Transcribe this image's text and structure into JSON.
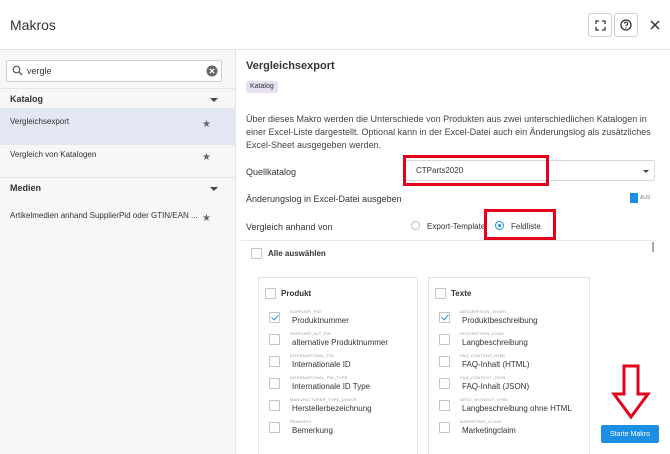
{
  "window": {
    "title": "Makros"
  },
  "toolbar": {
    "fullscreen_icon": "fullscreen-icon",
    "help_icon": "help-icon",
    "close_label": "✕"
  },
  "sidebar": {
    "search": {
      "value": "vergle",
      "placeholder": ""
    },
    "categories": [
      {
        "label": "Katalog",
        "items": [
          {
            "label": "Vergleichsexport",
            "active": true
          },
          {
            "label": "Vergleich von Katalogen",
            "active": false
          }
        ]
      },
      {
        "label": "Medien",
        "items": [
          {
            "label": "Artikelmedien anhand SupplierPid oder GTIN/EAN ...",
            "active": false
          }
        ]
      }
    ]
  },
  "main": {
    "title": "Vergleichsexport",
    "badge": "Katalog",
    "description": "Über dieses Makro werden die Unterschiede von Produkten aus zwei unterschiedlichen Katalogen in einer Excel-Liste dargestellt. Optional kann in der Excel-Datei auch ein Änderungslog als zusätzliches Excel-Sheet ausgegeben werden.",
    "source_label": "Quellkatalog",
    "source_value": "CTParts2020",
    "changelog_label": "Änderungslog in Excel-Datei ausgeben",
    "changelog_toggle": "AUS",
    "compare_label": "Vergleich anhand von",
    "compare_options": [
      {
        "label": "Export-Template",
        "selected": false
      },
      {
        "label": "Feldliste",
        "selected": true
      }
    ],
    "select_all": "Alle auswählen",
    "groups": [
      {
        "title": "Produkt",
        "fields": [
          {
            "key": "SUPPLIER_PID",
            "name": "Produktnummer",
            "checked": true
          },
          {
            "key": "SUPPLIER_ALT_PID",
            "name": "alternative Produktnummer",
            "checked": false
          },
          {
            "key": "INTERNATIONAL_PID",
            "name": "Internationale ID",
            "checked": false
          },
          {
            "key": "INTERNATIONAL_PID_TYPE",
            "name": "Internationale ID Type",
            "checked": false
          },
          {
            "key": "MANUFACTURER_TYPE_DESCR",
            "name": "Herstellerbezeichnung",
            "checked": false
          },
          {
            "key": "REMARKS",
            "name": "Bemerkung",
            "checked": false
          }
        ]
      },
      {
        "title": "Texte",
        "fields": [
          {
            "key": "DESCRIPTION_SHORT",
            "name": "Produktbeschreibung",
            "checked": true
          },
          {
            "key": "DESCRIPTION_LONG",
            "name": "Langbeschreibung",
            "checked": false
          },
          {
            "key": "FAQ_CONTENT_HTML",
            "name": "FAQ-Inhalt (HTML)",
            "checked": false
          },
          {
            "key": "FAQ_CONTENT_JSON",
            "name": "FAQ-Inhalt (JSON)",
            "checked": false
          },
          {
            "key": "DESC_WITHOUT_HTML",
            "name": "Langbeschreibung ohne HTML",
            "checked": false
          },
          {
            "key": "MARKETING_CLAIM",
            "name": "Marketingclaim",
            "checked": false
          }
        ]
      }
    ],
    "run_button": "Starte Makro"
  },
  "colors": {
    "accent": "#1a8fe3",
    "highlight": "#e3001b",
    "active_item": "#e3e7f3",
    "badge": "#e6e0f2"
  }
}
